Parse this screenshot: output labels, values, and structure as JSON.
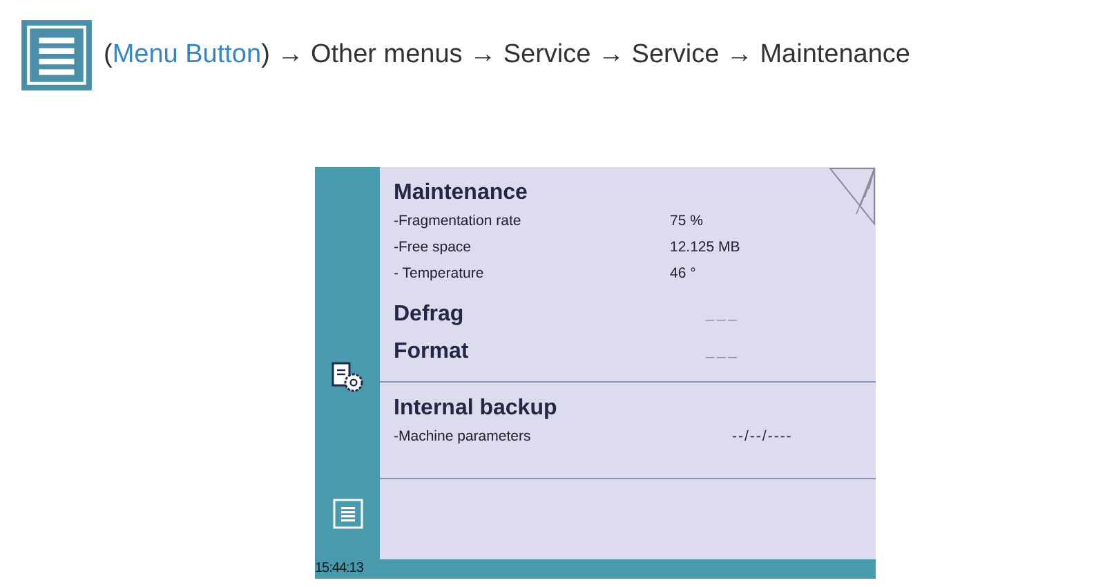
{
  "breadcrumb": {
    "prefix": "(",
    "link": "Menu Button",
    "suffix": ")",
    "separator": "→",
    "steps": [
      "Other menus",
      "Service",
      "Service",
      "Maintenance"
    ]
  },
  "screen": {
    "groups": [
      {
        "items": [
          {
            "kind": "heading",
            "title": "Maintenance"
          },
          {
            "kind": "row",
            "label": "-Fragmentation rate",
            "value": "75 %"
          },
          {
            "kind": "row",
            "label": "-Free space",
            "value": "12.125 MB"
          },
          {
            "kind": "row",
            "label": "- Temperature",
            "value": "46 °"
          },
          {
            "kind": "action",
            "title": "Defrag",
            "value": "___"
          },
          {
            "kind": "action",
            "title": "Format",
            "value": "___"
          }
        ]
      },
      {
        "items": [
          {
            "kind": "heading",
            "title": "Internal backup"
          },
          {
            "kind": "row",
            "label": "-Machine parameters",
            "value": "--/--/----"
          }
        ]
      }
    ],
    "clock": "15:44:13"
  }
}
